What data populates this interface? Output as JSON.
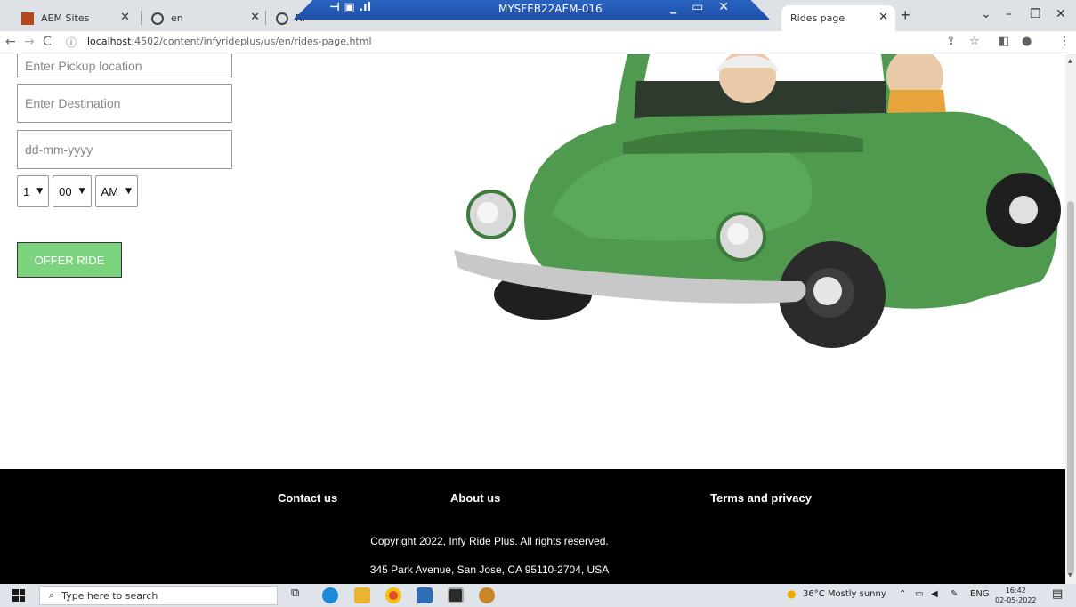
{
  "browser": {
    "tabs": [
      {
        "title": "AEM Sites"
      },
      {
        "title": "en"
      },
      {
        "title": "Ri"
      },
      {
        "title": "Rides page"
      }
    ],
    "rdp_title": "MYSFEB22AEM-016",
    "url_host": "localhost",
    "url_path": ":4502/content/infyrideplus/us/en/rides-page.html"
  },
  "form": {
    "pickup_placeholder": "Enter Pickup location",
    "destination_placeholder": "Enter Destination",
    "date_placeholder": "dd-mm-yyyy",
    "hour_value": "1",
    "minute_value": "00",
    "ampm_value": "AM",
    "offer_button": "OFFER RIDE"
  },
  "footer": {
    "links": [
      "Contact us",
      "About us",
      "Terms and privacy"
    ],
    "copyright": "Copyright 2022, Infy Ride Plus. All rights reserved.",
    "address": "345 Park Avenue, San Jose, CA 95110-2704, USA"
  },
  "taskbar": {
    "search_placeholder": "Type here to search",
    "weather": "36°C  Mostly sunny",
    "language": "ENG",
    "time": "16:42",
    "date": "02-05-2022"
  },
  "colors": {
    "offer_button": "#7bd47d",
    "footer_bg": "#000000",
    "car_green": "#4f9a4f",
    "rdp_bar": "#2a64c0"
  }
}
